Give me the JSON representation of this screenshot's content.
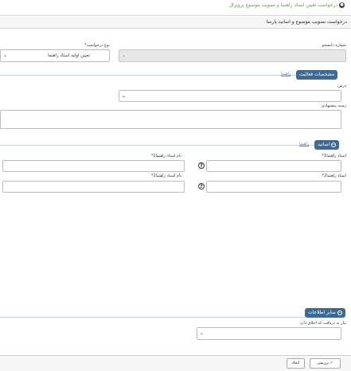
{
  "window": {
    "title": "درخواست تعیین استاد راهنما و تصویب موضوع پروپزال"
  },
  "form": {
    "header": "درخواست تصویب موضوع و اساتید پارسا"
  },
  "fields": {
    "student_number_label": "شماره دانشجو",
    "request_type_label": "نوع درخواست*",
    "request_type_value": "تعیین اولیه استاد راهنما"
  },
  "sections": {
    "activity": {
      "title": "مشخصات فعالیت",
      "guide_link": "راهنما",
      "course_label": "درس",
      "suggested_field_label": "زمینه پیشنهادی"
    },
    "professors": {
      "title": "اساتید",
      "guide_link": "راهنما",
      "advisor1_label": "استاد راهنما1*",
      "advisor1_name_label": "نام استاد راهنما1*",
      "advisor2_label": "استاد راهنما2*",
      "advisor2_name_label": "نام استاد راهنما2*"
    },
    "other": {
      "title": "سایر اطلاعات",
      "ethics_label": "نیاز به دریافت کد اخلاق دارد"
    }
  },
  "footer": {
    "review_label": "بررسی",
    "create_label": "ایجاد"
  },
  "icons": {
    "check": "check-icon",
    "chevron": "chevron-down-icon",
    "help": "help-icon",
    "collapse": "minus-circle-icon"
  }
}
